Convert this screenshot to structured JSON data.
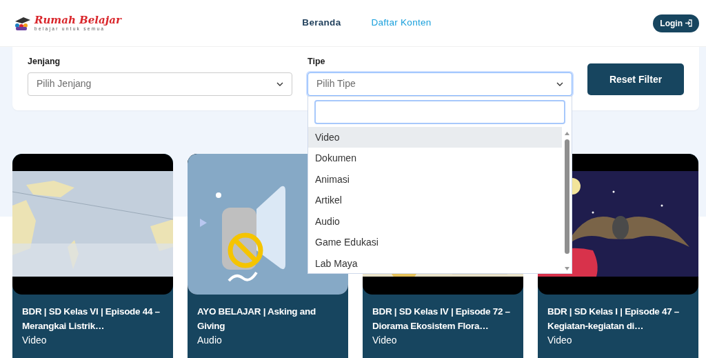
{
  "header": {
    "logo": {
      "title": "Rumah Belajar",
      "tagline": "belajar untuk semua"
    },
    "nav": [
      {
        "label": "Beranda",
        "selected": false
      },
      {
        "label": "Daftar Konten",
        "selected": true
      }
    ],
    "login": "Login"
  },
  "filters": [
    {
      "label": "Jenjang",
      "placeholder": "Pilih Jenjang",
      "open": false
    },
    {
      "label": "Tipe",
      "placeholder": "Pilih Tipe",
      "open": true,
      "options": [
        {
          "label": "Video",
          "selected": true
        },
        {
          "label": "Dokumen",
          "selected": false
        },
        {
          "label": "Animasi",
          "selected": false
        },
        {
          "label": "Artikel",
          "selected": false
        },
        {
          "label": "Audio",
          "selected": false
        },
        {
          "label": "Game Edukasi",
          "selected": false
        },
        {
          "label": "Lab Maya",
          "selected": false
        }
      ]
    }
  ],
  "reset_button": "Reset Filter",
  "cards": [
    {
      "title": "BDR | SD Kelas VI | Episode 44 – Merangkai Listrik…",
      "type": "Video"
    },
    {
      "title": "AYO BELAJAR | Asking and Giving",
      "type": "Audio"
    },
    {
      "title": "BDR | SD Kelas IV | Episode 72 – Diorama Ekosistem Flora…",
      "type": "Video"
    },
    {
      "title": "BDR | SD Kelas I | Episode 47 – Kegiatan-kegiatan di…",
      "type": "Video"
    }
  ]
}
